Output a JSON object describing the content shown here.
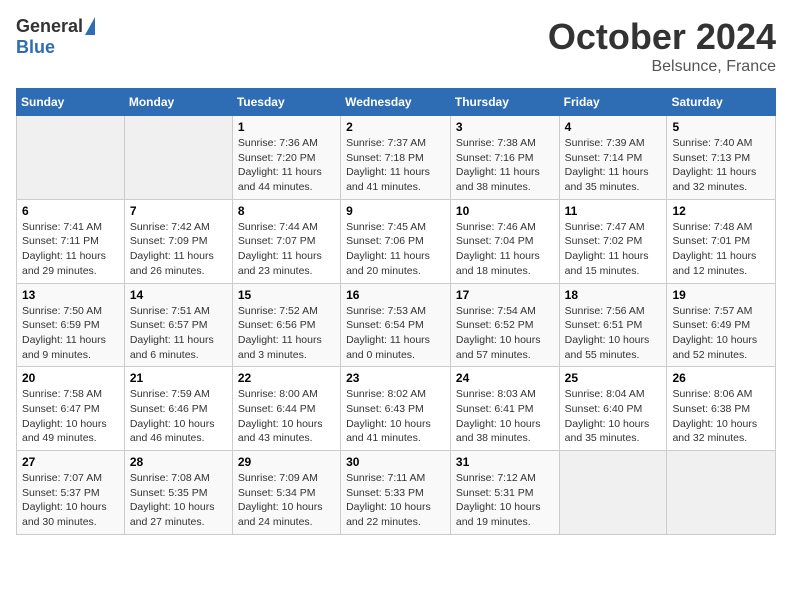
{
  "header": {
    "logo_general": "General",
    "logo_blue": "Blue",
    "month_title": "October 2024",
    "location": "Belsunce, France"
  },
  "days_of_week": [
    "Sunday",
    "Monday",
    "Tuesday",
    "Wednesday",
    "Thursday",
    "Friday",
    "Saturday"
  ],
  "weeks": [
    [
      {
        "day": "",
        "sunrise": "",
        "sunset": "",
        "daylight": ""
      },
      {
        "day": "",
        "sunrise": "",
        "sunset": "",
        "daylight": ""
      },
      {
        "day": "1",
        "sunrise": "Sunrise: 7:36 AM",
        "sunset": "Sunset: 7:20 PM",
        "daylight": "Daylight: 11 hours and 44 minutes."
      },
      {
        "day": "2",
        "sunrise": "Sunrise: 7:37 AM",
        "sunset": "Sunset: 7:18 PM",
        "daylight": "Daylight: 11 hours and 41 minutes."
      },
      {
        "day": "3",
        "sunrise": "Sunrise: 7:38 AM",
        "sunset": "Sunset: 7:16 PM",
        "daylight": "Daylight: 11 hours and 38 minutes."
      },
      {
        "day": "4",
        "sunrise": "Sunrise: 7:39 AM",
        "sunset": "Sunset: 7:14 PM",
        "daylight": "Daylight: 11 hours and 35 minutes."
      },
      {
        "day": "5",
        "sunrise": "Sunrise: 7:40 AM",
        "sunset": "Sunset: 7:13 PM",
        "daylight": "Daylight: 11 hours and 32 minutes."
      }
    ],
    [
      {
        "day": "6",
        "sunrise": "Sunrise: 7:41 AM",
        "sunset": "Sunset: 7:11 PM",
        "daylight": "Daylight: 11 hours and 29 minutes."
      },
      {
        "day": "7",
        "sunrise": "Sunrise: 7:42 AM",
        "sunset": "Sunset: 7:09 PM",
        "daylight": "Daylight: 11 hours and 26 minutes."
      },
      {
        "day": "8",
        "sunrise": "Sunrise: 7:44 AM",
        "sunset": "Sunset: 7:07 PM",
        "daylight": "Daylight: 11 hours and 23 minutes."
      },
      {
        "day": "9",
        "sunrise": "Sunrise: 7:45 AM",
        "sunset": "Sunset: 7:06 PM",
        "daylight": "Daylight: 11 hours and 20 minutes."
      },
      {
        "day": "10",
        "sunrise": "Sunrise: 7:46 AM",
        "sunset": "Sunset: 7:04 PM",
        "daylight": "Daylight: 11 hours and 18 minutes."
      },
      {
        "day": "11",
        "sunrise": "Sunrise: 7:47 AM",
        "sunset": "Sunset: 7:02 PM",
        "daylight": "Daylight: 11 hours and 15 minutes."
      },
      {
        "day": "12",
        "sunrise": "Sunrise: 7:48 AM",
        "sunset": "Sunset: 7:01 PM",
        "daylight": "Daylight: 11 hours and 12 minutes."
      }
    ],
    [
      {
        "day": "13",
        "sunrise": "Sunrise: 7:50 AM",
        "sunset": "Sunset: 6:59 PM",
        "daylight": "Daylight: 11 hours and 9 minutes."
      },
      {
        "day": "14",
        "sunrise": "Sunrise: 7:51 AM",
        "sunset": "Sunset: 6:57 PM",
        "daylight": "Daylight: 11 hours and 6 minutes."
      },
      {
        "day": "15",
        "sunrise": "Sunrise: 7:52 AM",
        "sunset": "Sunset: 6:56 PM",
        "daylight": "Daylight: 11 hours and 3 minutes."
      },
      {
        "day": "16",
        "sunrise": "Sunrise: 7:53 AM",
        "sunset": "Sunset: 6:54 PM",
        "daylight": "Daylight: 11 hours and 0 minutes."
      },
      {
        "day": "17",
        "sunrise": "Sunrise: 7:54 AM",
        "sunset": "Sunset: 6:52 PM",
        "daylight": "Daylight: 10 hours and 57 minutes."
      },
      {
        "day": "18",
        "sunrise": "Sunrise: 7:56 AM",
        "sunset": "Sunset: 6:51 PM",
        "daylight": "Daylight: 10 hours and 55 minutes."
      },
      {
        "day": "19",
        "sunrise": "Sunrise: 7:57 AM",
        "sunset": "Sunset: 6:49 PM",
        "daylight": "Daylight: 10 hours and 52 minutes."
      }
    ],
    [
      {
        "day": "20",
        "sunrise": "Sunrise: 7:58 AM",
        "sunset": "Sunset: 6:47 PM",
        "daylight": "Daylight: 10 hours and 49 minutes."
      },
      {
        "day": "21",
        "sunrise": "Sunrise: 7:59 AM",
        "sunset": "Sunset: 6:46 PM",
        "daylight": "Daylight: 10 hours and 46 minutes."
      },
      {
        "day": "22",
        "sunrise": "Sunrise: 8:00 AM",
        "sunset": "Sunset: 6:44 PM",
        "daylight": "Daylight: 10 hours and 43 minutes."
      },
      {
        "day": "23",
        "sunrise": "Sunrise: 8:02 AM",
        "sunset": "Sunset: 6:43 PM",
        "daylight": "Daylight: 10 hours and 41 minutes."
      },
      {
        "day": "24",
        "sunrise": "Sunrise: 8:03 AM",
        "sunset": "Sunset: 6:41 PM",
        "daylight": "Daylight: 10 hours and 38 minutes."
      },
      {
        "day": "25",
        "sunrise": "Sunrise: 8:04 AM",
        "sunset": "Sunset: 6:40 PM",
        "daylight": "Daylight: 10 hours and 35 minutes."
      },
      {
        "day": "26",
        "sunrise": "Sunrise: 8:06 AM",
        "sunset": "Sunset: 6:38 PM",
        "daylight": "Daylight: 10 hours and 32 minutes."
      }
    ],
    [
      {
        "day": "27",
        "sunrise": "Sunrise: 7:07 AM",
        "sunset": "Sunset: 5:37 PM",
        "daylight": "Daylight: 10 hours and 30 minutes."
      },
      {
        "day": "28",
        "sunrise": "Sunrise: 7:08 AM",
        "sunset": "Sunset: 5:35 PM",
        "daylight": "Daylight: 10 hours and 27 minutes."
      },
      {
        "day": "29",
        "sunrise": "Sunrise: 7:09 AM",
        "sunset": "Sunset: 5:34 PM",
        "daylight": "Daylight: 10 hours and 24 minutes."
      },
      {
        "day": "30",
        "sunrise": "Sunrise: 7:11 AM",
        "sunset": "Sunset: 5:33 PM",
        "daylight": "Daylight: 10 hours and 22 minutes."
      },
      {
        "day": "31",
        "sunrise": "Sunrise: 7:12 AM",
        "sunset": "Sunset: 5:31 PM",
        "daylight": "Daylight: 10 hours and 19 minutes."
      },
      {
        "day": "",
        "sunrise": "",
        "sunset": "",
        "daylight": ""
      },
      {
        "day": "",
        "sunrise": "",
        "sunset": "",
        "daylight": ""
      }
    ]
  ]
}
